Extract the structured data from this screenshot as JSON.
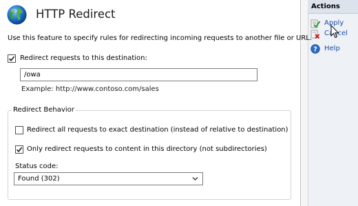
{
  "header": {
    "title": "HTTP Redirect",
    "icon": "globe-icon"
  },
  "description": "Use this feature to specify rules for redirecting incoming requests to another file or URL.",
  "redirect": {
    "checkbox_label": "Redirect requests to this destination:",
    "checked": true,
    "destination_value": "/owa",
    "example": "Example: http://www.contoso.com/sales"
  },
  "behavior": {
    "legend": "Redirect Behavior",
    "exact_label": "Redirect all requests to exact destination (instead of relative to destination)",
    "exact_checked": false,
    "directory_label": "Only redirect requests to content in this directory (not subdirectories)",
    "directory_checked": true,
    "status_label": "Status code:",
    "status_value": "Found (302)"
  },
  "actions": {
    "header": "Actions",
    "items": [
      {
        "label": "Apply",
        "icon": "apply-check-icon"
      },
      {
        "label": "Cancel",
        "icon": "cancel-x-icon"
      },
      {
        "label": "Help",
        "icon": "help-icon"
      }
    ]
  },
  "colors": {
    "link": "#1a4fa0",
    "actions_bg": "#eef1f6",
    "actions_header_bg": "#dde3ec"
  }
}
